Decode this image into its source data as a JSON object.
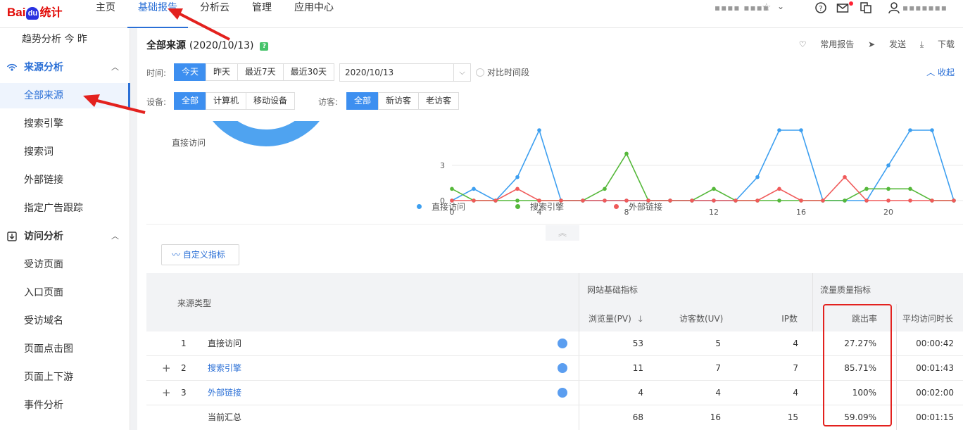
{
  "brand": {
    "bai": "Bai",
    "du": "du",
    "tongji": "统计"
  },
  "topnav": {
    "items": [
      "主页",
      "基础报告",
      "分析云",
      "管理",
      "应用中心"
    ],
    "active": "基础报告",
    "site": "▪▪▪▪ ▪▪▪▪",
    "username": "▪▪▪▪▪▪▪"
  },
  "sidebar": {
    "top_item": "趋势分析  今  昨",
    "group_source": "来源分析",
    "source_items": [
      "全部来源",
      "搜索引擎",
      "搜索词",
      "外部链接",
      "指定广告跟踪"
    ],
    "group_visit": "访问分析",
    "visit_items": [
      "受访页面",
      "入口页面",
      "受访域名",
      "页面点击图",
      "页面上下游",
      "事件分析"
    ],
    "active": "全部来源"
  },
  "header": {
    "title": "全部来源",
    "date": "(2020/10/13)",
    "actions": {
      "favorite": "常用报告",
      "send": "发送",
      "download": "下载"
    }
  },
  "filters": {
    "time_label": "时间:",
    "time_options": [
      "今天",
      "昨天",
      "最近7天",
      "最近30天"
    ],
    "time_active": "今天",
    "date_value": "2020/10/13",
    "compare_label": "对比时间段",
    "collapse_label": "收起",
    "device_label": "设备:",
    "device_options": [
      "全部",
      "计算机",
      "移动设备"
    ],
    "device_active": "全部",
    "visitor_label": "访客:",
    "visitor_options": [
      "全部",
      "新访客",
      "老访客"
    ],
    "visitor_active": "全部"
  },
  "donut": {
    "label": "直接访问",
    "color": "#4fa3f0"
  },
  "chart_data": {
    "type": "line",
    "x": [
      0,
      1,
      2,
      3,
      4,
      5,
      6,
      7,
      8,
      9,
      10,
      11,
      12,
      13,
      14,
      15,
      16,
      17,
      18,
      19,
      20,
      21,
      22,
      23
    ],
    "xticks": [
      0,
      4,
      8,
      12,
      16,
      20
    ],
    "yticks": [
      0,
      3
    ],
    "ylim": [
      0,
      6
    ],
    "series": [
      {
        "name": "直接访问",
        "color": "#3d9ff0",
        "values": [
          0,
          1,
          0,
          2,
          6,
          0,
          0,
          0,
          0,
          0,
          0,
          0,
          0,
          0,
          2,
          6,
          6,
          0,
          0,
          0,
          3,
          6,
          6,
          0
        ]
      },
      {
        "name": "搜索引擎",
        "color": "#55b83a",
        "values": [
          1,
          0,
          0,
          0,
          0,
          0,
          0,
          1,
          4,
          0,
          0,
          0,
          1,
          0,
          0,
          0,
          0,
          0,
          0,
          1,
          1,
          1,
          0,
          0
        ]
      },
      {
        "name": "外部链接",
        "color": "#f05a5a",
        "values": [
          0,
          0,
          0,
          1,
          0,
          0,
          0,
          0,
          0,
          0,
          0,
          0,
          0,
          0,
          0,
          1,
          0,
          0,
          2,
          0,
          0,
          0,
          0,
          0
        ]
      }
    ]
  },
  "custom_metric_label": "自定义指标",
  "table": {
    "source_type_header": "来源类型",
    "group_basic": "网站基础指标",
    "group_quality": "流量质量指标",
    "columns": [
      "浏览量(PV)",
      "访客数(UV)",
      "IP数",
      "跳出率",
      "平均访问时长"
    ],
    "rows": [
      {
        "index": "1",
        "name": "直接访问",
        "expandable": false,
        "pv": "53",
        "uv": "5",
        "ip": "4",
        "bounce": "27.27%",
        "avg": "00:00:42"
      },
      {
        "index": "2",
        "name": "搜索引擎",
        "expandable": true,
        "pv": "11",
        "uv": "7",
        "ip": "7",
        "bounce": "85.71%",
        "avg": "00:01:43"
      },
      {
        "index": "3",
        "name": "外部链接",
        "expandable": true,
        "pv": "4",
        "uv": "4",
        "ip": "4",
        "bounce": "100%",
        "avg": "00:02:00"
      }
    ],
    "total": {
      "name": "当前汇总",
      "pv": "68",
      "uv": "16",
      "ip": "15",
      "bounce": "59.09%",
      "avg": "00:01:15"
    }
  }
}
